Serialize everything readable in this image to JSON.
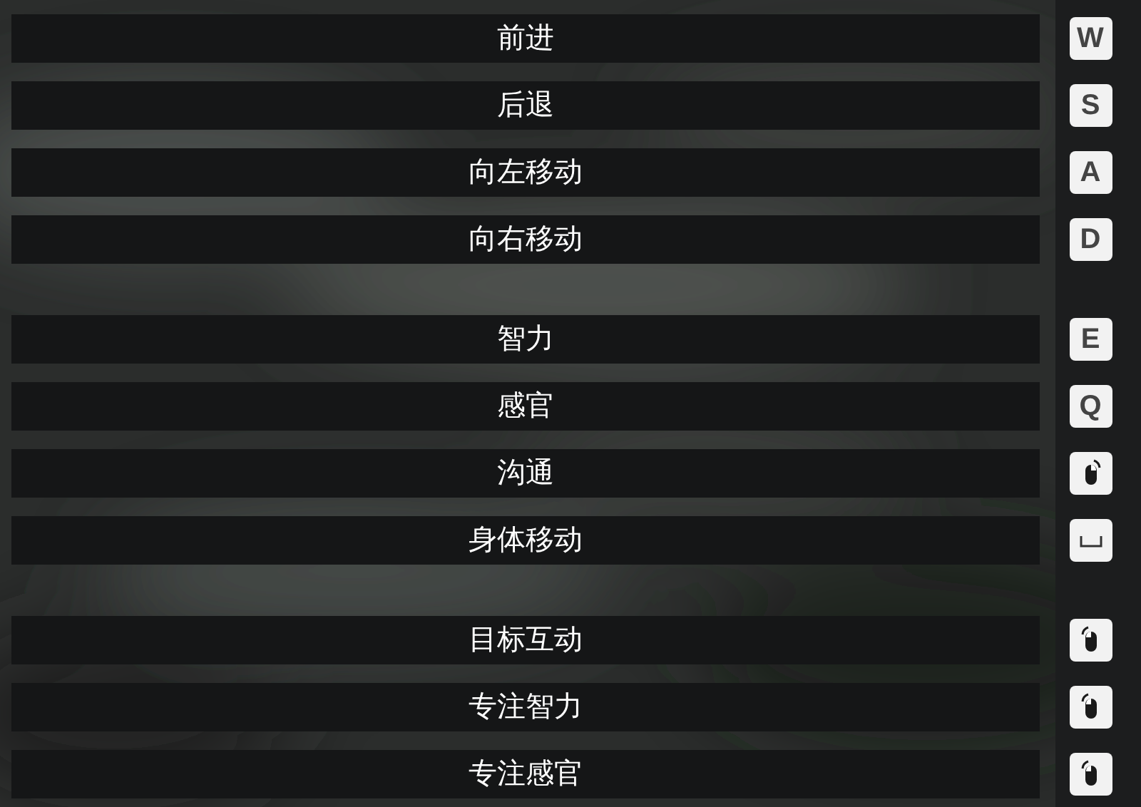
{
  "groups": [
    {
      "rows": [
        {
          "label": "前进",
          "key": {
            "kind": "letter",
            "text": "W"
          }
        },
        {
          "label": "后退",
          "key": {
            "kind": "letter",
            "text": "S"
          }
        },
        {
          "label": "向左移动",
          "key": {
            "kind": "letter",
            "text": "A"
          }
        },
        {
          "label": "向右移动",
          "key": {
            "kind": "letter",
            "text": "D"
          }
        }
      ]
    },
    {
      "rows": [
        {
          "label": "智力",
          "key": {
            "kind": "letter",
            "text": "E"
          }
        },
        {
          "label": "感官",
          "key": {
            "kind": "letter",
            "text": "Q"
          }
        },
        {
          "label": "沟通",
          "key": {
            "kind": "mouse",
            "right_button": true
          }
        },
        {
          "label": "身体移动",
          "key": {
            "kind": "space"
          }
        }
      ]
    },
    {
      "rows": [
        {
          "label": "目标互动",
          "key": {
            "kind": "mouse",
            "right_button": false
          }
        },
        {
          "label": "专注智力",
          "key": {
            "kind": "mouse",
            "right_button": false
          }
        },
        {
          "label": "专注感官",
          "key": {
            "kind": "mouse",
            "right_button": false
          }
        }
      ]
    }
  ]
}
